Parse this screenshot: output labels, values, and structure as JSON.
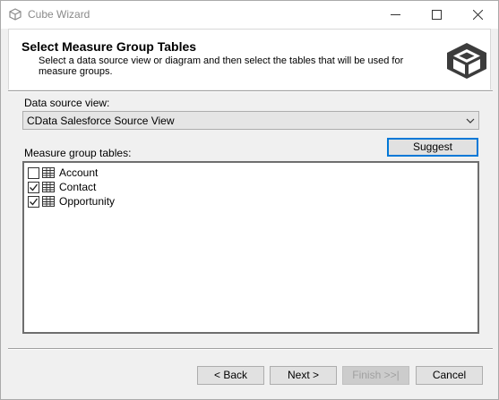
{
  "window": {
    "title": "Cube Wizard"
  },
  "header": {
    "title": "Select Measure Group Tables",
    "description": "Select a data source view or diagram and then select the tables that will be used for measure groups."
  },
  "data_source": {
    "label": "Data source view:",
    "selected": "CData Salesforce Source View"
  },
  "measure_group": {
    "label": "Measure group tables:",
    "suggest_label": "Suggest",
    "items": [
      {
        "label": "Account",
        "checked": false
      },
      {
        "label": "Contact",
        "checked": true
      },
      {
        "label": "Opportunity",
        "checked": true
      }
    ]
  },
  "footer": {
    "back_label": "< Back",
    "next_label": "Next >",
    "finish_label": "Finish >>|",
    "cancel_label": "Cancel"
  },
  "colors": {
    "accent": "#0078d7",
    "logo": "#3c3c3c"
  }
}
